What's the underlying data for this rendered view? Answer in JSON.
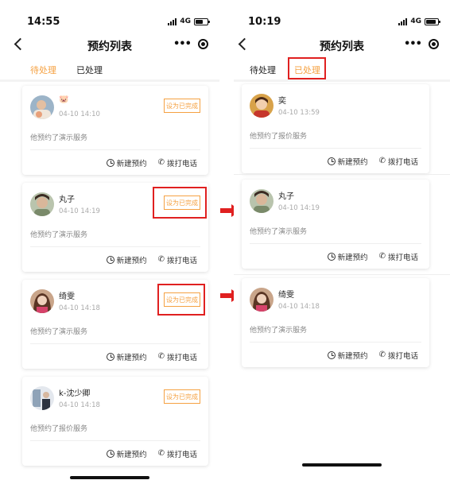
{
  "left": {
    "time": "14:55",
    "network": "4G",
    "title": "预约列表",
    "tabs": [
      "待处理",
      "已处理"
    ],
    "cards": [
      {
        "name": "🐷",
        "date": "04-10 14:10",
        "button": "设为已完成",
        "service": "他预约了演示服务",
        "action1": "新建预约",
        "action2": "拨打电话"
      },
      {
        "name": "丸子",
        "date": "04-10 14:19",
        "button": "设为已完成",
        "service": "他预约了演示服务",
        "action1": "新建预约",
        "action2": "拨打电话"
      },
      {
        "name": "绮雯",
        "date": "04-10 14:18",
        "button": "设为已完成",
        "service": "他预约了演示服务",
        "action1": "新建预约",
        "action2": "拨打电话"
      },
      {
        "name": "k-沈少卿",
        "date": "04-10 14:18",
        "button": "设为已完成",
        "service": "他预约了报价服务",
        "action1": "新建预约",
        "action2": "拨打电话"
      }
    ]
  },
  "right": {
    "time": "10:19",
    "network": "4G",
    "title": "预约列表",
    "tabs": [
      "待处理",
      "已处理"
    ],
    "cards": [
      {
        "name": "奕",
        "date": "04-10 13:59",
        "service": "他预约了报价服务",
        "action1": "新建预约",
        "action2": "拨打电话"
      },
      {
        "name": "丸子",
        "date": "04-10 14:19",
        "service": "他预约了演示服务",
        "action1": "新建预约",
        "action2": "拨打电话"
      },
      {
        "name": "绮雯",
        "date": "04-10 14:18",
        "service": "他预约了演示服务",
        "action1": "新建预约",
        "action2": "拨打电话"
      }
    ]
  },
  "colors": {
    "accent": "#f5a142",
    "highlight": "#e02020"
  },
  "icons": [
    "back-icon",
    "more-dots-icon",
    "target-icon",
    "clock-icon",
    "phone-icon",
    "arrow-right-icon"
  ]
}
